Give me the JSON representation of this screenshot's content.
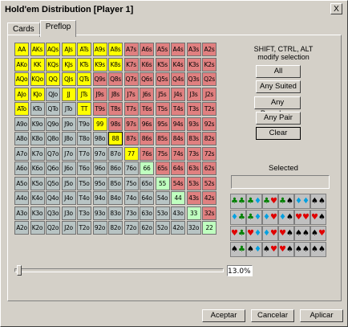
{
  "window": {
    "title": "Hold'em Distribution [Player 1]",
    "close_label": "X"
  },
  "tabs": [
    {
      "label": "Cards"
    },
    {
      "label": "Preflop"
    }
  ],
  "grid": {
    "rows": [
      [
        "AA",
        "AKs",
        "AQs",
        "AJs",
        "ATs",
        "A9s",
        "A8s",
        "A7s",
        "A6s",
        "A5s",
        "A4s",
        "A3s",
        "A2s"
      ],
      [
        "AKo",
        "KK",
        "KQs",
        "KJs",
        "KTs",
        "K9s",
        "K8s",
        "K7s",
        "K6s",
        "K5s",
        "K4s",
        "K3s",
        "K2s"
      ],
      [
        "AQo",
        "KQo",
        "QQ",
        "QJs",
        "QTs",
        "Q9s",
        "Q8s",
        "Q7s",
        "Q6s",
        "Q5s",
        "Q4s",
        "Q3s",
        "Q2s"
      ],
      [
        "AJo",
        "KJo",
        "QJo",
        "JJ",
        "JTs",
        "J9s",
        "J8s",
        "J7s",
        "J6s",
        "J5s",
        "J4s",
        "J3s",
        "J2s"
      ],
      [
        "ATo",
        "KTo",
        "QTo",
        "JTo",
        "TT",
        "T9s",
        "T8s",
        "T7s",
        "T6s",
        "T5s",
        "T4s",
        "T3s",
        "T2s"
      ],
      [
        "A9o",
        "K9o",
        "Q9o",
        "J9o",
        "T9o",
        "99",
        "98s",
        "97s",
        "96s",
        "95s",
        "94s",
        "93s",
        "92s"
      ],
      [
        "A8o",
        "K8o",
        "Q8o",
        "J8o",
        "T8o",
        "98o",
        "88",
        "87s",
        "86s",
        "85s",
        "84s",
        "83s",
        "82s"
      ],
      [
        "A7o",
        "K7o",
        "Q7o",
        "J7o",
        "T7o",
        "97o",
        "87o",
        "77",
        "76s",
        "75s",
        "74s",
        "73s",
        "72s"
      ],
      [
        "A6o",
        "K6o",
        "Q6o",
        "J6o",
        "T6o",
        "96o",
        "86o",
        "76o",
        "66",
        "65s",
        "64s",
        "63s",
        "62s"
      ],
      [
        "A5o",
        "K5o",
        "Q5o",
        "J5o",
        "T5o",
        "95o",
        "85o",
        "75o",
        "65o",
        "55",
        "54s",
        "53s",
        "52s"
      ],
      [
        "A4o",
        "K4o",
        "Q4o",
        "J4o",
        "T4o",
        "94o",
        "84o",
        "74o",
        "64o",
        "54o",
        "44",
        "43s",
        "42s"
      ],
      [
        "A3o",
        "K3o",
        "Q3o",
        "J3o",
        "T3o",
        "93o",
        "83o",
        "73o",
        "63o",
        "53o",
        "43o",
        "33",
        "32s"
      ],
      [
        "A2o",
        "K2o",
        "Q2o",
        "J2o",
        "T2o",
        "92o",
        "82o",
        "72o",
        "62o",
        "52o",
        "42o",
        "32o",
        "22"
      ]
    ],
    "states": [
      "YYYYYYYRRRRRR",
      "YYYYYYYRRRRRR",
      "YYYYYRRRRRRRR",
      "YYGYYRRRRRRRR",
      "YGGGYRRRRRRRR",
      "GGGGGYRRRRRRR",
      "GGGGGGSRRRRRR",
      "GGGGGGGYRRRRR",
      "GGGGGGGGLRRRR",
      "GGGGGGGGGLRRR",
      "GGGGGGGGGGLRR",
      "GGGGGGGGGGGLR",
      "GGGGGGGGGGGGL"
    ],
    "colors": {
      "selected": "#ffff00",
      "suited": "#e08080",
      "offsuit": "#b8c4c4",
      "pair": "#bfffbf"
    }
  },
  "slider": {
    "percent_label": "13.0%",
    "value": 0.13
  },
  "side": {
    "hint_line1": "SHIFT, CTRL, ALT",
    "hint_line2": "modify selection",
    "buttons": [
      {
        "label": "All"
      },
      {
        "label": "Any Suited"
      },
      {
        "label": "Any Broadway"
      },
      {
        "label": "Any Pair"
      },
      {
        "label": "Clear"
      }
    ],
    "selected_label": "Selected",
    "selected_value": ""
  },
  "suit_grid": {
    "rows": [
      [
        "cc",
        "cd",
        "ch",
        "cs",
        "dd",
        "ss"
      ],
      [
        "dc",
        "cd",
        "dh",
        "ds",
        "hh",
        "hs"
      ],
      [
        "hc",
        "hd",
        "dh",
        "hs",
        "ss",
        "sh"
      ],
      [
        "sc",
        "sd",
        "sh",
        "hs",
        "ss",
        "ss"
      ]
    ],
    "colors": {
      "c": "#008000",
      "d": "#00a0e0",
      "h": "#e00000",
      "s": "#000000"
    }
  },
  "footer": {
    "accept": "Aceptar",
    "cancel": "Cancelar",
    "apply": "Aplicar"
  }
}
